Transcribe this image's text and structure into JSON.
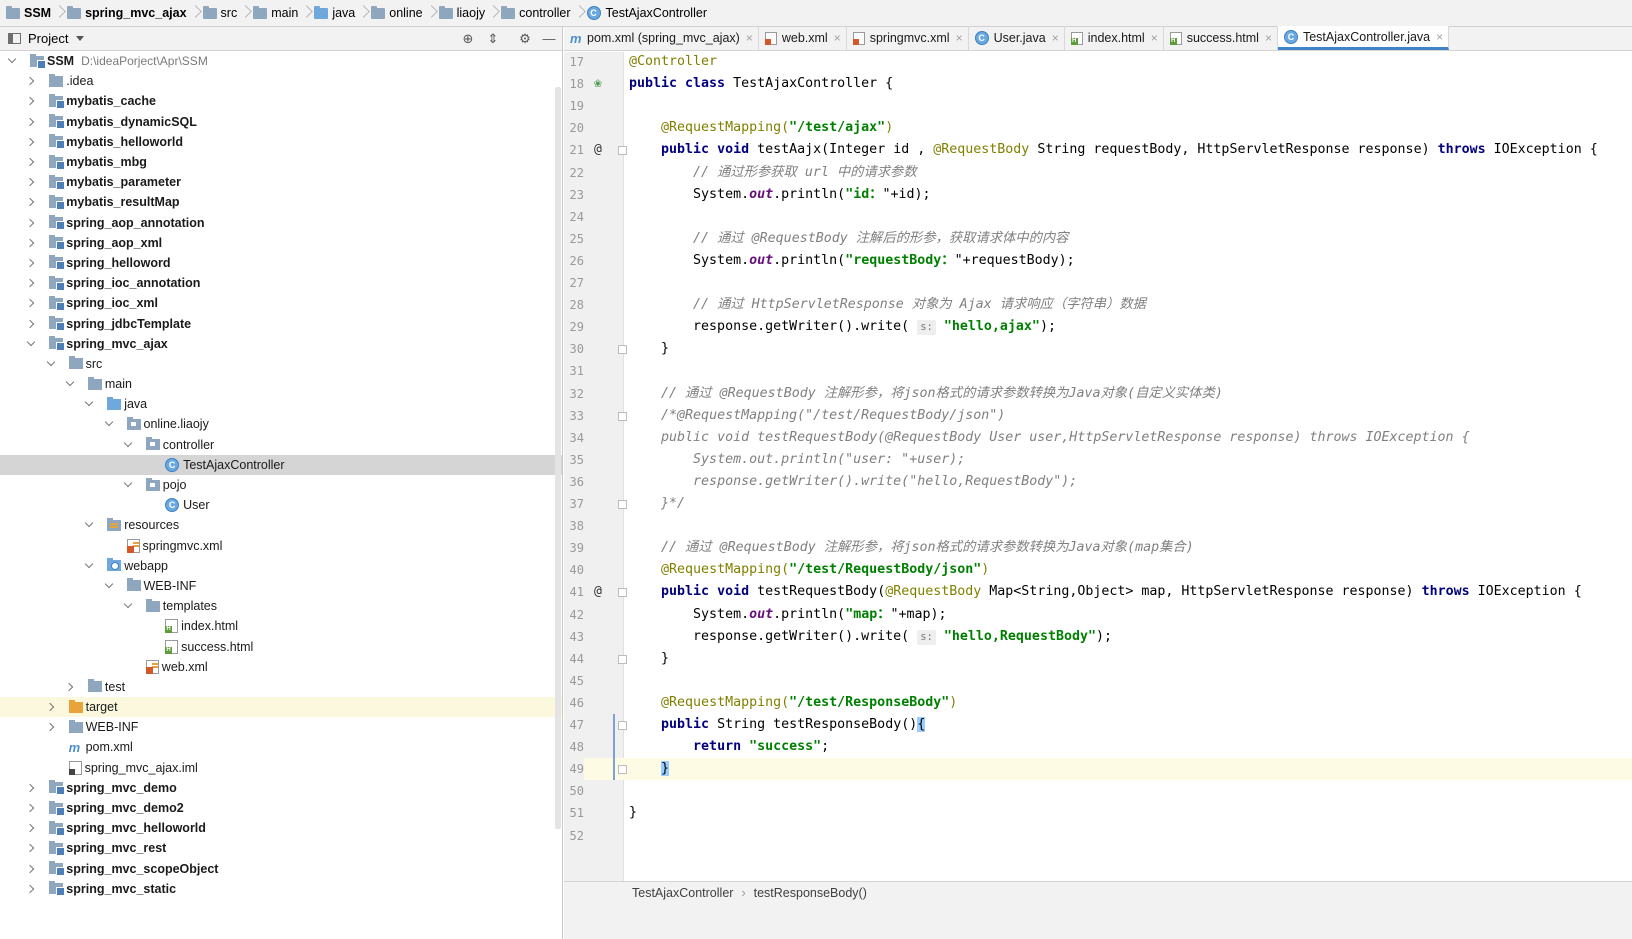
{
  "breadcrumb": [
    {
      "label": "SSM",
      "icon": "module-folder-icon",
      "bold": true
    },
    {
      "label": "spring_mvc_ajax",
      "icon": "module-folder-icon",
      "bold": true
    },
    {
      "label": "src",
      "icon": "folder-icon"
    },
    {
      "label": "main",
      "icon": "folder-icon"
    },
    {
      "label": "java",
      "icon": "source-folder-icon"
    },
    {
      "label": "online",
      "icon": "folder-icon"
    },
    {
      "label": "liaojy",
      "icon": "folder-icon"
    },
    {
      "label": "controller",
      "icon": "folder-icon"
    },
    {
      "label": "TestAjaxController",
      "icon": "class-icon"
    }
  ],
  "project_panel": {
    "title": "Project",
    "tree": [
      {
        "label": "SSM",
        "path": "D:\\ideaPorject\\Apr\\SSM",
        "indent": 0,
        "arrow": "down",
        "icon": "module",
        "bold": true
      },
      {
        "label": ".idea",
        "indent": 1,
        "arrow": "right",
        "icon": "folder"
      },
      {
        "label": "mybatis_cache",
        "indent": 1,
        "arrow": "right",
        "icon": "module",
        "bold": true
      },
      {
        "label": "mybatis_dynamicSQL",
        "indent": 1,
        "arrow": "right",
        "icon": "module",
        "bold": true
      },
      {
        "label": "mybatis_helloworld",
        "indent": 1,
        "arrow": "right",
        "icon": "module",
        "bold": true
      },
      {
        "label": "mybatis_mbg",
        "indent": 1,
        "arrow": "right",
        "icon": "module",
        "bold": true
      },
      {
        "label": "mybatis_parameter",
        "indent": 1,
        "arrow": "right",
        "icon": "module",
        "bold": true
      },
      {
        "label": "mybatis_resultMap",
        "indent": 1,
        "arrow": "right",
        "icon": "module",
        "bold": true
      },
      {
        "label": "spring_aop_annotation",
        "indent": 1,
        "arrow": "right",
        "icon": "module",
        "bold": true
      },
      {
        "label": "spring_aop_xml",
        "indent": 1,
        "arrow": "right",
        "icon": "module",
        "bold": true
      },
      {
        "label": "spring_helloword",
        "indent": 1,
        "arrow": "right",
        "icon": "module",
        "bold": true
      },
      {
        "label": "spring_ioc_annotation",
        "indent": 1,
        "arrow": "right",
        "icon": "module",
        "bold": true
      },
      {
        "label": "spring_ioc_xml",
        "indent": 1,
        "arrow": "right",
        "icon": "module",
        "bold": true
      },
      {
        "label": "spring_jdbcTemplate",
        "indent": 1,
        "arrow": "right",
        "icon": "module",
        "bold": true
      },
      {
        "label": "spring_mvc_ajax",
        "indent": 1,
        "arrow": "down",
        "icon": "module",
        "bold": true
      },
      {
        "label": "src",
        "indent": 2,
        "arrow": "down",
        "icon": "folder"
      },
      {
        "label": "main",
        "indent": 3,
        "arrow": "down",
        "icon": "folder"
      },
      {
        "label": "java",
        "indent": 4,
        "arrow": "down",
        "icon": "src"
      },
      {
        "label": "online.liaojy",
        "indent": 5,
        "arrow": "down",
        "icon": "pkg"
      },
      {
        "label": "controller",
        "indent": 6,
        "arrow": "down",
        "icon": "pkg"
      },
      {
        "label": "TestAjaxController",
        "indent": 7,
        "arrow": "none",
        "icon": "class",
        "selected": true
      },
      {
        "label": "pojo",
        "indent": 6,
        "arrow": "down",
        "icon": "pkg"
      },
      {
        "label": "User",
        "indent": 7,
        "arrow": "none",
        "icon": "class"
      },
      {
        "label": "resources",
        "indent": 4,
        "arrow": "down",
        "icon": "res"
      },
      {
        "label": "springmvc.xml",
        "indent": 5,
        "arrow": "none",
        "icon": "xml"
      },
      {
        "label": "webapp",
        "indent": 4,
        "arrow": "down",
        "icon": "web"
      },
      {
        "label": "WEB-INF",
        "indent": 5,
        "arrow": "down",
        "icon": "folder"
      },
      {
        "label": "templates",
        "indent": 6,
        "arrow": "down",
        "icon": "folder"
      },
      {
        "label": "index.html",
        "indent": 7,
        "arrow": "none",
        "icon": "html"
      },
      {
        "label": "success.html",
        "indent": 7,
        "arrow": "none",
        "icon": "html"
      },
      {
        "label": "web.xml",
        "indent": 6,
        "arrow": "none",
        "icon": "xml"
      },
      {
        "label": "test",
        "indent": 3,
        "arrow": "right",
        "icon": "folder"
      },
      {
        "label": "target",
        "indent": 2,
        "arrow": "right",
        "icon": "orange",
        "highlight": true
      },
      {
        "label": "WEB-INF",
        "indent": 2,
        "arrow": "right",
        "icon": "folder"
      },
      {
        "label": "pom.xml",
        "indent": 2,
        "arrow": "none",
        "icon": "maven"
      },
      {
        "label": "spring_mvc_ajax.iml",
        "indent": 2,
        "arrow": "none",
        "icon": "iml"
      },
      {
        "label": "spring_mvc_demo",
        "indent": 1,
        "arrow": "right",
        "icon": "module",
        "bold": true
      },
      {
        "label": "spring_mvc_demo2",
        "indent": 1,
        "arrow": "right",
        "icon": "module",
        "bold": true
      },
      {
        "label": "spring_mvc_helloworld",
        "indent": 1,
        "arrow": "right",
        "icon": "module",
        "bold": true
      },
      {
        "label": "spring_mvc_rest",
        "indent": 1,
        "arrow": "right",
        "icon": "module",
        "bold": true
      },
      {
        "label": "spring_mvc_scopeObject",
        "indent": 1,
        "arrow": "right",
        "icon": "module",
        "bold": true
      },
      {
        "label": "spring_mvc_static",
        "indent": 1,
        "arrow": "right",
        "icon": "module",
        "bold": true
      }
    ]
  },
  "editor_tabs": [
    {
      "label": "pom.xml (spring_mvc_ajax)",
      "icon": "maven"
    },
    {
      "label": "web.xml",
      "icon": "xml"
    },
    {
      "label": "springmvc.xml",
      "icon": "xml"
    },
    {
      "label": "User.java",
      "icon": "class"
    },
    {
      "label": "index.html",
      "icon": "html"
    },
    {
      "label": "success.html",
      "icon": "html"
    },
    {
      "label": "TestAjaxController.java",
      "icon": "class",
      "active": true
    }
  ],
  "code": {
    "current_line": 49,
    "lines": [
      {
        "n": 17,
        "tokens": [
          [
            "anno",
            "@Controller"
          ]
        ]
      },
      {
        "n": 18,
        "gutter": "bean",
        "tokens": [
          [
            "kw",
            "public class "
          ],
          [
            "",
            "TestAjaxController {"
          ]
        ]
      },
      {
        "n": 19,
        "tokens": []
      },
      {
        "n": 20,
        "tokens": [
          [
            "",
            "    "
          ],
          [
            "anno",
            "@RequestMapping("
          ],
          [
            "str",
            "\"/test/ajax\""
          ],
          [
            "anno",
            ")"
          ]
        ]
      },
      {
        "n": 21,
        "gutter": "at",
        "fold": true,
        "tokens": [
          [
            "",
            "    "
          ],
          [
            "kw",
            "public void "
          ],
          [
            "",
            "testAajx(Integer id , "
          ],
          [
            "anno",
            "@RequestBody "
          ],
          [
            "",
            "String requestBody, HttpServletResponse response) "
          ],
          [
            "kw",
            "throws "
          ],
          [
            "",
            "IOException {"
          ]
        ]
      },
      {
        "n": 22,
        "tokens": [
          [
            "",
            "        "
          ],
          [
            "cmt",
            "// 通过形参获取 url 中的请求参数"
          ]
        ]
      },
      {
        "n": 23,
        "tokens": [
          [
            "",
            "        System."
          ],
          [
            "field",
            "out"
          ],
          [
            "",
            ".println("
          ],
          [
            "str",
            "\"id："
          ],
          [
            "",
            "\"+id);"
          ]
        ]
      },
      {
        "n": 24,
        "tokens": []
      },
      {
        "n": 25,
        "tokens": [
          [
            "",
            "        "
          ],
          [
            "cmt",
            "// 通过 @RequestBody 注解后的形参，获取请求体中的内容"
          ]
        ]
      },
      {
        "n": 26,
        "tokens": [
          [
            "",
            "        System."
          ],
          [
            "field",
            "out"
          ],
          [
            "",
            ".println("
          ],
          [
            "str",
            "\"requestBody："
          ],
          [
            "",
            "\"+requestBody);"
          ]
        ]
      },
      {
        "n": 27,
        "tokens": []
      },
      {
        "n": 28,
        "tokens": [
          [
            "",
            "        "
          ],
          [
            "cmt",
            "// 通过 HttpServletResponse 对象为 Ajax 请求响应（字符串）数据"
          ]
        ]
      },
      {
        "n": 29,
        "tokens": [
          [
            "",
            "        response.getWriter().write( "
          ],
          [
            "hint",
            "s:"
          ],
          [
            "",
            " "
          ],
          [
            "str",
            "\"hello,ajax\""
          ],
          [
            "",
            ");"
          ]
        ]
      },
      {
        "n": 30,
        "fold": true,
        "tokens": [
          [
            "",
            "    }"
          ]
        ]
      },
      {
        "n": 31,
        "tokens": []
      },
      {
        "n": 32,
        "tokens": [
          [
            "",
            "    "
          ],
          [
            "cmt",
            "// 通过 @RequestBody 注解形参，将json格式的请求参数转换为Java对象(自定义实体类)"
          ]
        ]
      },
      {
        "n": 33,
        "fold": true,
        "tokens": [
          [
            "",
            "    "
          ],
          [
            "cmt",
            "/*@RequestMapping(\"/test/RequestBody/json\")"
          ]
        ]
      },
      {
        "n": 34,
        "tokens": [
          [
            "",
            "    "
          ],
          [
            "cmt",
            "public void testRequestBody(@RequestBody User user,HttpServletResponse response) throws IOException {"
          ]
        ]
      },
      {
        "n": 35,
        "tokens": [
          [
            "",
            "        "
          ],
          [
            "cmt",
            "System.out.println(\"user: \"+user);"
          ]
        ]
      },
      {
        "n": 36,
        "tokens": [
          [
            "",
            "        "
          ],
          [
            "cmt",
            "response.getWriter().write(\"hello,RequestBody\");"
          ]
        ]
      },
      {
        "n": 37,
        "fold": true,
        "tokens": [
          [
            "",
            "    "
          ],
          [
            "cmt",
            "}*/"
          ]
        ]
      },
      {
        "n": 38,
        "tokens": []
      },
      {
        "n": 39,
        "tokens": [
          [
            "",
            "    "
          ],
          [
            "cmt",
            "// 通过 @RequestBody 注解形参，将json格式的请求参数转换为Java对象(map集合)"
          ]
        ]
      },
      {
        "n": 40,
        "tokens": [
          [
            "",
            "    "
          ],
          [
            "anno",
            "@RequestMapping("
          ],
          [
            "str",
            "\"/test/RequestBody/json\""
          ],
          [
            "anno",
            ")"
          ]
        ]
      },
      {
        "n": 41,
        "gutter": "at",
        "fold": true,
        "tokens": [
          [
            "",
            "    "
          ],
          [
            "kw",
            "public void "
          ],
          [
            "",
            "testRequestBody("
          ],
          [
            "anno",
            "@RequestBody "
          ],
          [
            "",
            "Map<String,Object> map, HttpServletResponse response) "
          ],
          [
            "kw",
            "throws "
          ],
          [
            "",
            "IOException {"
          ]
        ]
      },
      {
        "n": 42,
        "tokens": [
          [
            "",
            "        System."
          ],
          [
            "field",
            "out"
          ],
          [
            "",
            ".println("
          ],
          [
            "str",
            "\"map："
          ],
          [
            "",
            "\"+map);"
          ]
        ]
      },
      {
        "n": 43,
        "tokens": [
          [
            "",
            "        response.getWriter().write( "
          ],
          [
            "hint",
            "s:"
          ],
          [
            "",
            " "
          ],
          [
            "str",
            "\"hello,RequestBody\""
          ],
          [
            "",
            ");"
          ]
        ]
      },
      {
        "n": 44,
        "fold": true,
        "tokens": [
          [
            "",
            "    }"
          ]
        ]
      },
      {
        "n": 45,
        "tokens": []
      },
      {
        "n": 46,
        "tokens": [
          [
            "",
            "    "
          ],
          [
            "anno",
            "@RequestMapping("
          ],
          [
            "str",
            "\"/test/ResponseBody\""
          ],
          [
            "anno",
            ")"
          ]
        ]
      },
      {
        "n": 47,
        "fold": true,
        "tokens": [
          [
            "",
            "    "
          ],
          [
            "kw",
            "public "
          ],
          [
            "",
            "String testResponseBody()"
          ],
          [
            "brace",
            "{"
          ]
        ]
      },
      {
        "n": 48,
        "tokens": [
          [
            "",
            "        "
          ],
          [
            "kw",
            "return "
          ],
          [
            "str",
            "\"success\""
          ],
          [
            "",
            ";"
          ]
        ]
      },
      {
        "n": 49,
        "fold": true,
        "tokens": [
          [
            "",
            "    "
          ],
          [
            "brace",
            "}"
          ]
        ]
      },
      {
        "n": 50,
        "tokens": []
      },
      {
        "n": 51,
        "tokens": [
          [
            "",
            "}"
          ]
        ]
      },
      {
        "n": 52,
        "tokens": []
      }
    ]
  },
  "status_breadcrumb": [
    "TestAjaxController",
    "testResponseBody()"
  ],
  "colors": {
    "accent": "#4083c9",
    "selection": "#d5d5d5",
    "current_line": "#fefbe4",
    "keyword": "#000080",
    "annotation": "#808000",
    "string": "#008000",
    "comment": "#808080"
  }
}
